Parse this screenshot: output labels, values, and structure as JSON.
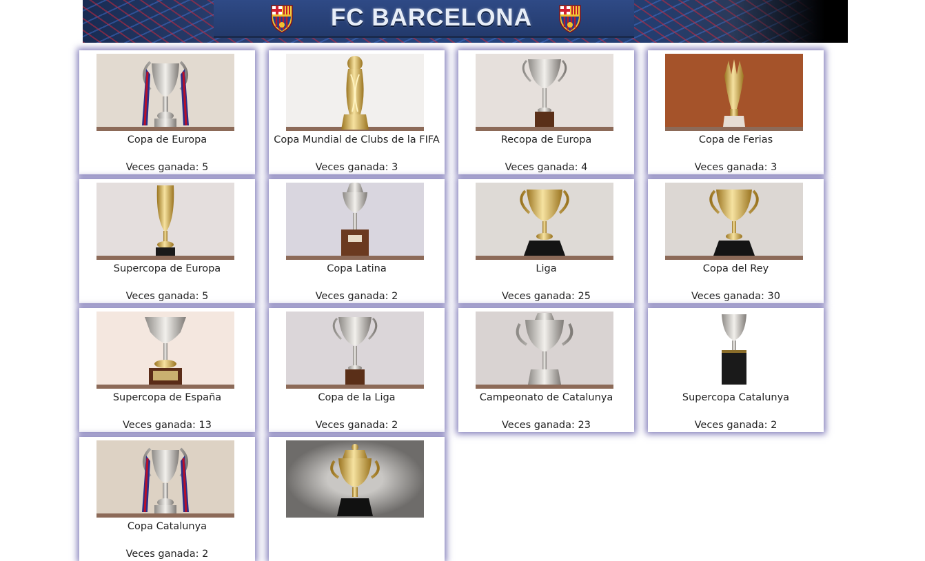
{
  "header": {
    "title": "FC BARCELONA",
    "accent": "#243d6f"
  },
  "count_label": "Veces ganada:",
  "trophies": [
    {
      "name": "Copa de Europa",
      "count": "Veces ganada: 5",
      "bg": "#e2dad0",
      "style": "big-ears",
      "ribbons": true
    },
    {
      "name": "Copa Mundial de Clubs de la FIFA",
      "count": "Veces ganada: 3",
      "bg": "#f2f0ee",
      "style": "twisted",
      "ribbons": false
    },
    {
      "name": "Recopa de Europa",
      "count": "Veces ganada: 4",
      "bg": "#e6e0dc",
      "style": "cup-wood",
      "ribbons": false
    },
    {
      "name": "Copa de Ferias",
      "count": "Veces ganada: 3",
      "bg": "#a5532a",
      "style": "spire",
      "ribbons": false
    },
    {
      "name": "Supercopa de Europa",
      "count": "Veces ganada: 5",
      "bg": "#e4dedd",
      "style": "tall-slim",
      "ribbons": false
    },
    {
      "name": "Copa Latina",
      "count": "Veces ganada: 2",
      "bg": "#d9d6df",
      "style": "lidded-wood",
      "ribbons": false
    },
    {
      "name": "Liga",
      "count": "Veces ganada: 25",
      "bg": "#dedad6",
      "style": "cup-black",
      "ribbons": false
    },
    {
      "name": "Copa del Rey",
      "count": "Veces ganada: 30",
      "bg": "#dcd7d3",
      "style": "cup-black",
      "ribbons": false
    },
    {
      "name": "Supercopa de España",
      "count": "Veces ganada: 13",
      "bg": "#f4e7df",
      "style": "wide-plaque",
      "ribbons": false
    },
    {
      "name": "Copa de la Liga",
      "count": "Veces ganada: 2",
      "bg": "#dbd6d9",
      "style": "cup-wood",
      "ribbons": false
    },
    {
      "name": "Campeonato de Catalunya",
      "count": "Veces ganada: 23",
      "bg": "#d9d3d2",
      "style": "ornate",
      "ribbons": false
    },
    {
      "name": "Supercopa Catalunya",
      "count": "Veces ganada: 2",
      "bg": "#ffffff",
      "style": "cylinder",
      "ribbons": false
    },
    {
      "name": "Copa Catalunya",
      "count": "Veces ganada: 2",
      "bg": "#ddd2c4",
      "style": "big-ears",
      "ribbons": true
    },
    {
      "name": "",
      "count": "",
      "bg": "#8e8c8a",
      "style": "lidded-black",
      "ribbons": false
    }
  ]
}
